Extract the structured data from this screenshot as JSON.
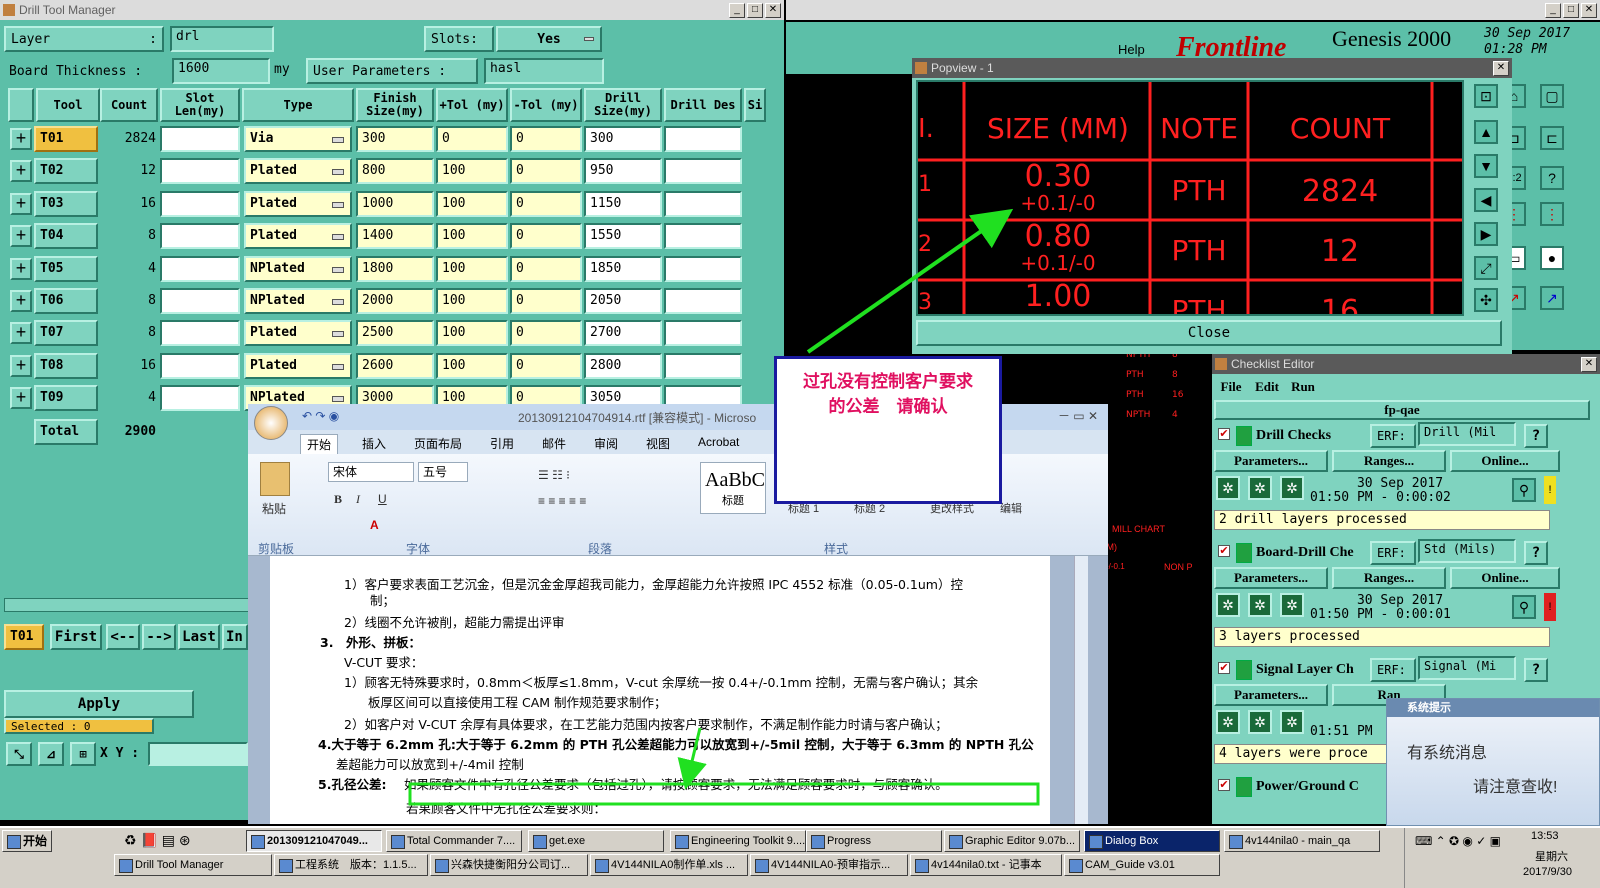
{
  "drill_tool_manager": {
    "title": "Drill Tool Manager",
    "layer_label": "Layer",
    "layer_sep": ":",
    "layer_value": "drl",
    "slots_label": "Slots:",
    "slots_value": "Yes",
    "board_thickness_label": "Board Thickness :",
    "board_thickness_value": "1600",
    "board_thickness_unit": "my",
    "user_params_label": "User Parameters :",
    "user_params_value": "hasl",
    "columns": [
      "Tool",
      "Count",
      "Slot Len(my)",
      "Type",
      "Finish Size(my)",
      "+Tol (my)",
      "-Tol (my)",
      "Drill Size(my)",
      "Drill Des",
      "Si"
    ],
    "rows": [
      {
        "tool": "T01",
        "count": "2824",
        "type": "Via",
        "finish": "300",
        "ptol": "0",
        "ntol": "0",
        "drill": "300"
      },
      {
        "tool": "T02",
        "count": "12",
        "type": "Plated",
        "finish": "800",
        "ptol": "100",
        "ntol": "0",
        "drill": "950"
      },
      {
        "tool": "T03",
        "count": "16",
        "type": "Plated",
        "finish": "1000",
        "ptol": "100",
        "ntol": "0",
        "drill": "1150"
      },
      {
        "tool": "T04",
        "count": "8",
        "type": "Plated",
        "finish": "1400",
        "ptol": "100",
        "ntol": "0",
        "drill": "1550"
      },
      {
        "tool": "T05",
        "count": "4",
        "type": "NPlated",
        "finish": "1800",
        "ptol": "100",
        "ntol": "0",
        "drill": "1850"
      },
      {
        "tool": "T06",
        "count": "8",
        "type": "NPlated",
        "finish": "2000",
        "ptol": "100",
        "ntol": "0",
        "drill": "2050"
      },
      {
        "tool": "T07",
        "count": "8",
        "type": "Plated",
        "finish": "2500",
        "ptol": "100",
        "ntol": "0",
        "drill": "2700"
      },
      {
        "tool": "T08",
        "count": "16",
        "type": "Plated",
        "finish": "2600",
        "ptol": "100",
        "ntol": "0",
        "drill": "2800"
      },
      {
        "tool": "T09",
        "count": "4",
        "type": "NPlated",
        "finish": "3000",
        "ptol": "100",
        "ntol": "0",
        "drill": "3050"
      }
    ],
    "total_label": "Total",
    "total_value": "2900",
    "current_tool": "T01",
    "nav": {
      "first": "First",
      "prev": "<--",
      "next": "-->",
      "last": "Last",
      "in": "In"
    },
    "apply": "Apply",
    "selected_label": "Selected : 0",
    "xy_label": "X Y :"
  },
  "genesis": {
    "help": "Help",
    "brand": "Frontline",
    "product": "Genesis 2000",
    "date": "30 Sep 2017",
    "time": "01:28 PM"
  },
  "popview": {
    "title": "Popview - 1",
    "headers": [
      "SIZE (MM)",
      "NOTE",
      "COUNT"
    ],
    "row_indices": [
      "1",
      "1",
      "2",
      "3"
    ],
    "rows": [
      {
        "size": "0.30",
        "tol": "+0.1/-0",
        "note": "PTH",
        "count": "2824"
      },
      {
        "size": "0.80",
        "tol": "+0.1/-0",
        "note": "PTH",
        "count": "12"
      },
      {
        "size": "1.00",
        "tol": "",
        "note": "PTH",
        "count": "16"
      }
    ],
    "close": "Close"
  },
  "bg_table": {
    "values": [
      "PTH",
      "1.00 +0.1/-0",
      "PTH",
      "18",
      "1.40 +0.1/-0",
      "PTH",
      "8",
      "NPTH",
      "4",
      "NPTH",
      "8",
      "PTH",
      "8",
      "PTH",
      "16",
      "NPTH",
      "4"
    ],
    "mill_chart": "MILL CHART",
    "mm": "(MM)",
    "tol": "+/-0.1",
    "non": "NON P"
  },
  "annotation": {
    "line1": "过孔没有控制客户要求",
    "line2": "的公差　请确认"
  },
  "checklist": {
    "title": "Checklist Editor",
    "menu": [
      "File",
      "Edit",
      "Run"
    ],
    "name": "fp-qae",
    "erf_label": "ERF:",
    "params_btn": "Parameters...",
    "ranges_btn": "Ranges...",
    "online_btn": "Online...",
    "items": [
      {
        "name": "Drill Checks",
        "erf": "Drill (Mil",
        "date": "30 Sep 2017",
        "time": "01:50 PM - 0:00:02",
        "status": "2 drill layers processed"
      },
      {
        "name": "Board-Drill Che",
        "erf": "Std (Mils)",
        "date": "30 Sep 2017",
        "time": "01:50 PM - 0:00:01",
        "status": "3 layers processed"
      },
      {
        "name": "Signal Layer Ch",
        "erf": "Signal (Mi",
        "date": "30",
        "time": "01:51 PM",
        "status": "4 layers were proce"
      },
      {
        "name": "Power/Ground C",
        "erf": "",
        "date": "",
        "time": "",
        "status": ""
      }
    ],
    "ranges_short": "Ran",
    "help": "?"
  },
  "word": {
    "title": "20130912104704914.rtf [兼容模式] - Microso",
    "tabs": [
      "开始",
      "插入",
      "页面布局",
      "引用",
      "邮件",
      "审阅",
      "视图",
      "Acrobat"
    ],
    "font_name": "宋体",
    "font_size": "五号",
    "paste": "粘贴",
    "group_clipboard": "剪贴板",
    "group_font": "字体",
    "group_para": "段落",
    "group_style": "样式",
    "style_sample": "AaBbC",
    "style_name1": "标题",
    "style_name2": "标题 1",
    "style_name3": "标题 2",
    "change_style": "更改样式",
    "edit": "编辑",
    "lines": [
      "1）客户要求表面工艺沉金，但是沉金金厚超我司能力，金厚超能力允许按照 IPC 4552 标准（0.05-0.1um）控",
      "制；",
      "2）线圈不允许被削，超能力需提出评审",
      "3.　外形、拼板：",
      "V-CUT 要求：",
      "1）顾客无特殊要求时，0.8mm＜板厚≤1.8mm，V-cut 余厚统一按 0.4+/-0.1mm 控制，无需与客户确认；其余",
      "板厚区间可以直接使用工程 CAM 制作规范要求制作；",
      "2）如客户对 V-CUT 余厚有具体要求，在工艺能力范围内按客户要求制作，不满足制作能力时请与客户确认；",
      "4.大于等于 6.2mm 孔:大于等于 6.2mm 的 PTH 孔公差超能力可以放宽到+/-5mil 控制，大于等于 6.3mm 的 NPTH 孔公",
      "差超能力可以放宽到+/-4mil 控制",
      "5.孔径公差:",
      "如果顾客文件中有孔径公差要求（包括过孔），请按顾客要求，无法满足顾客要求时，与顾客确认。",
      "若果顾客文件中无孔径公差要求则："
    ]
  },
  "sysmsg": {
    "title": "系统提示",
    "line1": "有系统消息",
    "line2": "请注意查收!"
  },
  "taskbar": {
    "start": "开始",
    "row1": [
      "201309121047049...",
      "Total Commander 7....",
      "get.exe",
      "Engineering Toolkit 9....",
      "Progress",
      "Graphic Editor 9.07b...",
      "Dialog Box",
      "4v144nila0 - main_qa"
    ],
    "row2": [
      "Drill Tool Manager",
      "工程系统　版本：1.1.5...",
      "兴森快捷衡阳分公司订...",
      "4V144NILA0制作单.xls ...",
      "4V144NILA0-预审指示...",
      "4v144nila0.txt - 记事本",
      "CAM_Guide v3.01"
    ],
    "clock_time": "13:53",
    "clock_day": "星期六",
    "clock_date": "2017/9/30"
  }
}
